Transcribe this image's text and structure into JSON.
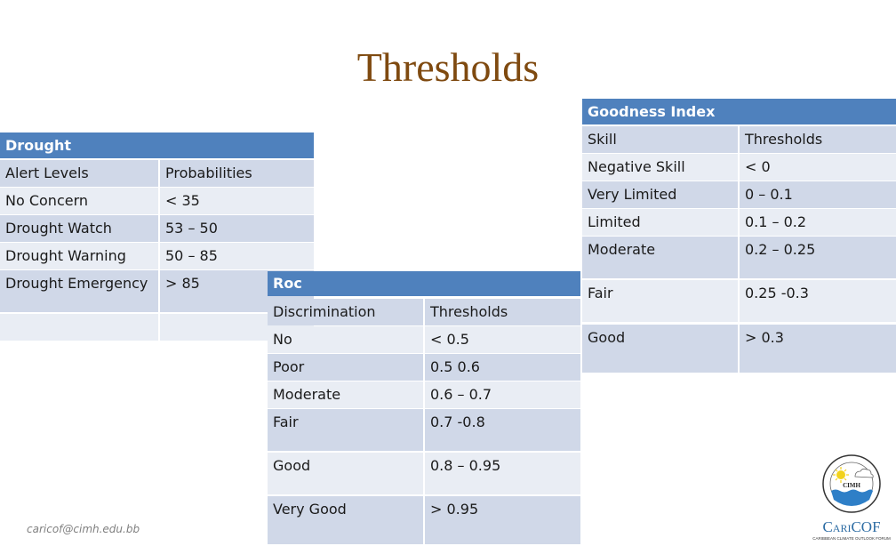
{
  "slide": {
    "title": "Thresholds",
    "footer_email": "caricof@cimh.edu.bb",
    "logo": {
      "ring_text": "Caribbean Institute for Meteorology and Hydrology",
      "center_text": "CIMH",
      "brand": "CariCOF",
      "tagline": "CARIBBEAN CLIMATE OUTLOOK FORUM"
    }
  },
  "drought": {
    "title": "Drought",
    "columns": [
      "Alert Levels",
      "Probabilities"
    ],
    "rows": [
      [
        "No Concern",
        "< 35"
      ],
      [
        "Drought Watch",
        "53 – 50"
      ],
      [
        "Drought Warning",
        "50 – 85"
      ],
      [
        "Drought Emergency",
        "> 85"
      ],
      [
        "",
        ""
      ]
    ]
  },
  "roc": {
    "title": "Roc",
    "columns": [
      "Discrimination",
      "Thresholds"
    ],
    "rows": [
      [
        "No",
        "< 0.5"
      ],
      [
        "Poor",
        "0.5 0.6"
      ],
      [
        "Moderate",
        "0.6 – 0.7"
      ],
      [
        "Fair",
        "0.7 -0.8"
      ],
      [
        "Good",
        "0.8 – 0.95"
      ],
      [
        "Very Good",
        "> 0.95"
      ]
    ]
  },
  "goodness": {
    "title": "Goodness Index",
    "columns": [
      "Skill",
      "Thresholds"
    ],
    "rows": [
      [
        "Negative Skill",
        "< 0"
      ],
      [
        "Very Limited",
        "0 – 0.1"
      ],
      [
        "Limited",
        "0.1 – 0.2"
      ],
      [
        "Moderate",
        "0.2 – 0.25"
      ],
      [
        "Fair",
        "0.25 -0.3"
      ],
      [
        "Good",
        "> 0.3"
      ]
    ]
  },
  "colors": {
    "header": "#4f81bd",
    "row_dark": "#d0d8e8",
    "row_light": "#e9edf4",
    "title": "#7f4a10"
  }
}
